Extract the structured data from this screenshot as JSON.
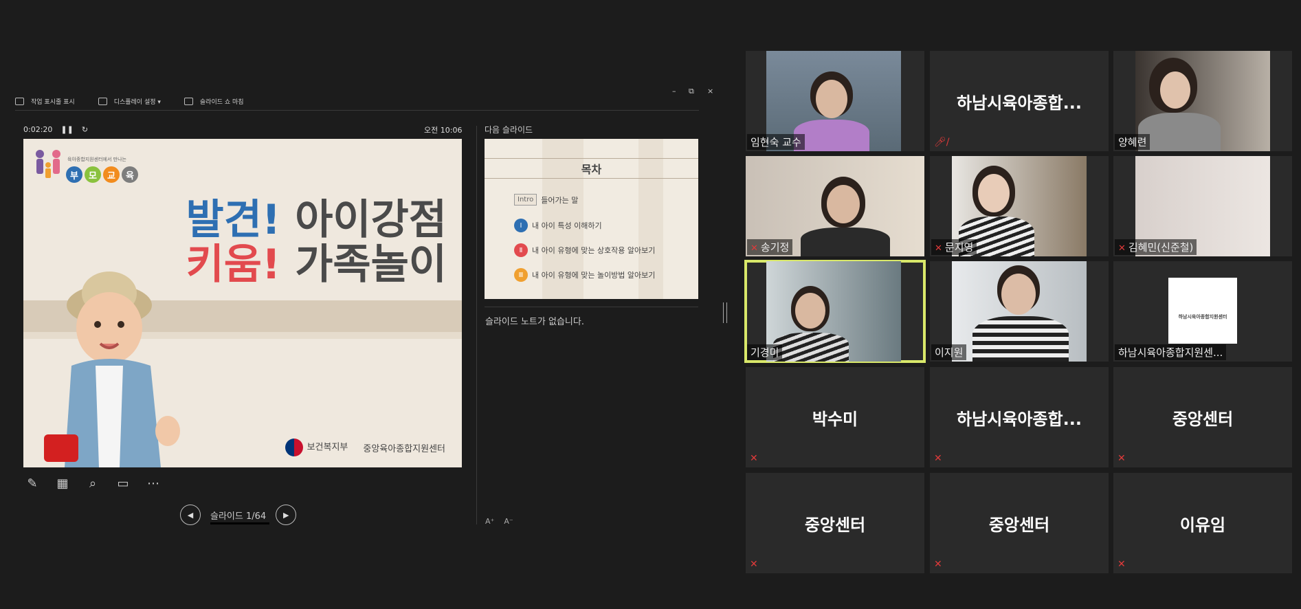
{
  "presenter": {
    "toolbar": {
      "taskbar_label": "작업 표시줄 표시",
      "display_label": "디스플레이 설정 ▾",
      "endshow_label": "슬라이드 쇼 마침"
    },
    "window_controls": {
      "minimize": "–",
      "restore": "⧉",
      "close": "×"
    },
    "timer": "0:02:20",
    "clock": "오전 10:06",
    "current_slide": {
      "org_small": "육아종합지원센터에서 만나는",
      "logo_chars": [
        "부",
        "모",
        "교",
        "육"
      ],
      "logo_colors": [
        "#2e6fb2",
        "#8ac23e",
        "#f28c1e",
        "#7d7d7d"
      ],
      "headline_1_accent": "발견!",
      "headline_1_rest": "아이강점",
      "headline_2_accent": "키움!",
      "headline_2_rest": "가족놀이",
      "footer_ministry": "보건복지부",
      "footer_center": "중앙육아종합지원센터"
    },
    "slide_counter": "슬라이드 1/64",
    "next_slide_label": "다음 슬라이드",
    "next_slide": {
      "title": "목차",
      "intro_tag": "Intro",
      "intro_text": "들어가는 말",
      "items": [
        {
          "num": "Ⅰ",
          "text": "내 아이 특성 이해하기",
          "color": "#2e6fb2"
        },
        {
          "num": "Ⅱ",
          "text": "내 아이 유형에 맞는 상호작용 알아보기",
          "color": "#e24a4e"
        },
        {
          "num": "Ⅲ",
          "text": "내 아이 유형에 맞는 놀이방법 알아보기",
          "color": "#f0a030"
        }
      ]
    },
    "notes": "슬라이드 노트가 없습니다.",
    "font_increase": "A⁺",
    "font_decrease": "A⁻"
  },
  "participants": [
    {
      "name": "임현숙 교수",
      "video": true,
      "muted": false
    },
    {
      "name": "하남시육아종합...",
      "video": false,
      "muted": true
    },
    {
      "name": "양혜련",
      "video": true,
      "muted": false
    },
    {
      "name": "송기정",
      "video": true,
      "muted": true
    },
    {
      "name": "문지영",
      "video": true,
      "muted": true
    },
    {
      "name": "김혜민(신준철)",
      "video": true,
      "muted": true
    },
    {
      "name": "기경미",
      "video": true,
      "muted": false,
      "active": true
    },
    {
      "name": "이지원",
      "video": true,
      "muted": false
    },
    {
      "name": "하남시육아종합지원센...",
      "video": true,
      "muted": false,
      "logo_text": "하남시육아종합지원센터"
    },
    {
      "name": "박수미",
      "video": false,
      "muted": true
    },
    {
      "name": "하남시육아종합...",
      "video": false,
      "muted": true
    },
    {
      "name": "중앙센터",
      "video": false,
      "muted": true
    },
    {
      "name": "중앙센터",
      "video": false,
      "muted": true
    },
    {
      "name": "중앙센터",
      "video": false,
      "muted": true
    },
    {
      "name": "이유임",
      "video": false,
      "muted": true
    }
  ],
  "colors": {
    "active_speaker": "#d9e86a",
    "mute_icon": "#e03a3a"
  }
}
